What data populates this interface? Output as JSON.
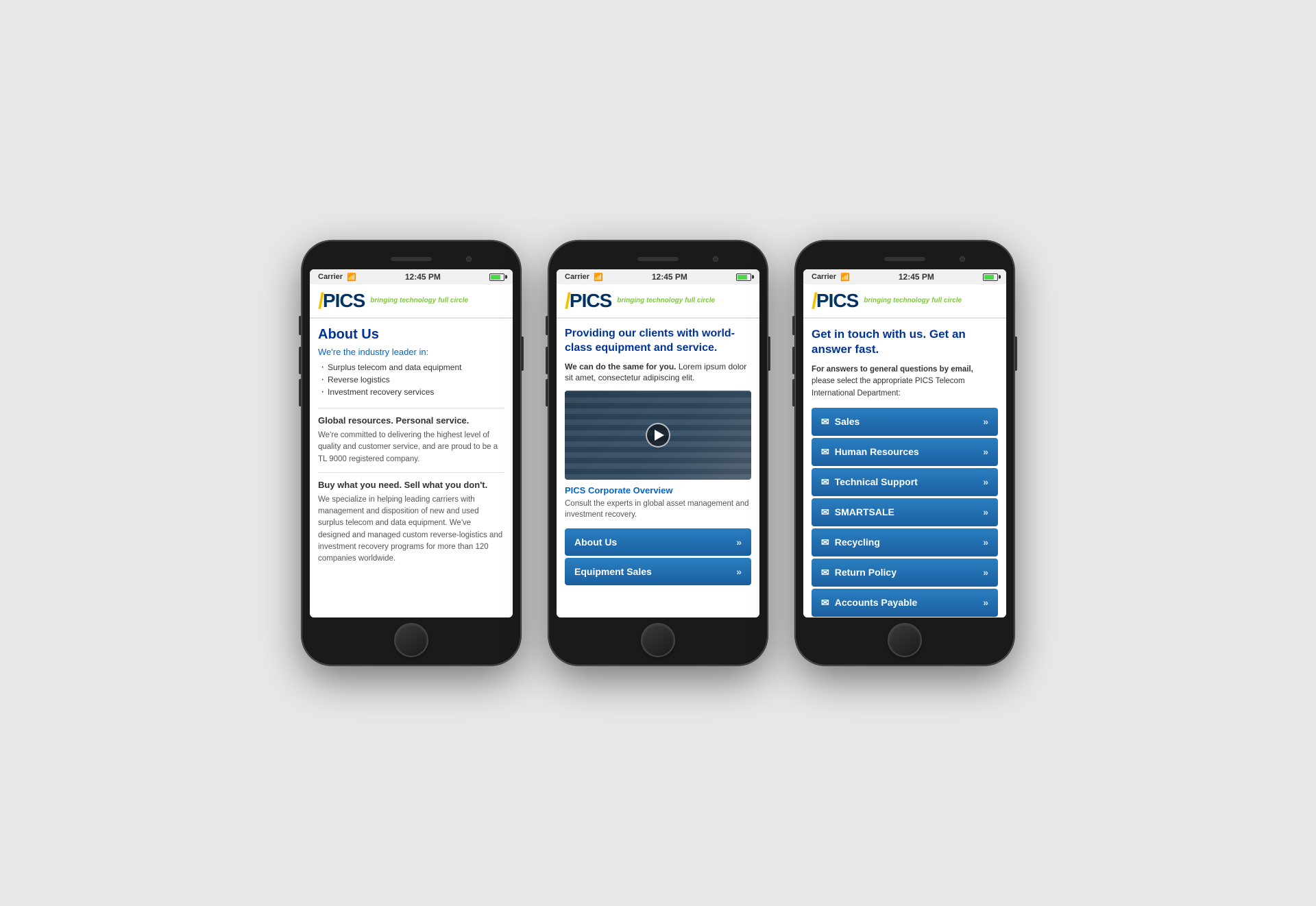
{
  "background": "#e8e8e8",
  "phones": [
    {
      "id": "phone1",
      "status_bar": {
        "carrier": "Carrier",
        "time": "12:45 PM"
      },
      "header": {
        "logo_letter": "P",
        "logo_text": "ICS",
        "tagline": "bringing technology full circle"
      },
      "page": "about",
      "about": {
        "title": "About Us",
        "subtitle": "We're the industry leader in:",
        "list": [
          "Surplus telecom and data equipment",
          "Reverse logistics",
          "Investment recovery services"
        ],
        "section1_heading": "Global resources. Personal service.",
        "section1_text": "We're committed to delivering the highest level of quality and customer service, and are proud to be a TL 9000 registered company.",
        "section2_heading": "Buy what you need. Sell what you don't.",
        "section2_text": "We specialize in helping leading carriers with management and disposition of new and used surplus telecom and data equipment. We've designed and managed custom reverse-logistics and investment recovery programs for more than 120 companies worldwide."
      }
    },
    {
      "id": "phone2",
      "status_bar": {
        "carrier": "Carrier",
        "time": "12:45 PM"
      },
      "header": {
        "logo_letter": "P",
        "logo_text": "ICS",
        "tagline": "bringing technology full circle"
      },
      "page": "video",
      "video": {
        "title": "Providing our clients with world-class equipment and service.",
        "intro_bold": "We can do the same for you.",
        "intro_text": " Lorem ipsum dolor sit amet, consectetur adipiscing elit.",
        "video_caption": "PICS Corporate Overview",
        "video_desc": "Consult the experts in global asset management and investment recovery.",
        "nav_buttons": [
          {
            "label": "About Us",
            "arrow": "»"
          },
          {
            "label": "Equipment Sales",
            "arrow": "»"
          }
        ]
      }
    },
    {
      "id": "phone3",
      "status_bar": {
        "carrier": "Carrier",
        "time": "12:45 PM"
      },
      "header": {
        "logo_letter": "P",
        "logo_text": "ICS",
        "tagline": "bringing technology full circle"
      },
      "page": "contact",
      "contact": {
        "title": "Get in touch with us. Get an answer fast.",
        "intro_bold": "For answers to general questions by email,",
        "intro_text": " please select the appropriate PICS Telecom International Department:",
        "departments": [
          {
            "label": "Sales",
            "arrow": "»"
          },
          {
            "label": "Human Resources",
            "arrow": "»"
          },
          {
            "label": "Technical Support",
            "arrow": "»"
          },
          {
            "label": "SMARTSALE",
            "arrow": "»"
          },
          {
            "label": "Recycling",
            "arrow": "»"
          },
          {
            "label": "Return Policy",
            "arrow": "»"
          },
          {
            "label": "Accounts Payable",
            "arrow": "»"
          }
        ]
      }
    }
  ]
}
